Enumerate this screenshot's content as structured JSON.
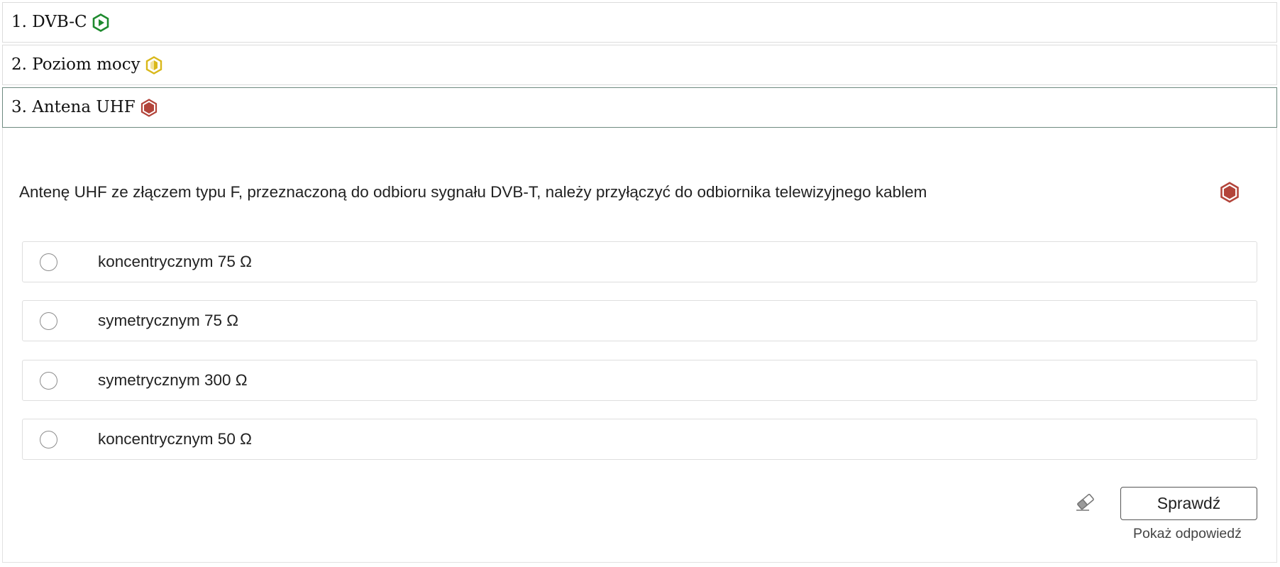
{
  "sections": [
    {
      "label": "1. DVB-C",
      "status_icon": "hexagon-play-icon",
      "status_color": "#1e8a2e"
    },
    {
      "label": "2. Poziom mocy",
      "status_icon": "hexagon-half-icon",
      "status_color": "#d9b81a"
    },
    {
      "label": "3. Antena UHF",
      "status_icon": "hexagon-filled-icon",
      "status_color": "#b3443a"
    }
  ],
  "question": {
    "text": "Antenę UHF ze złączem typu F, przeznaczoną do odbioru sygnału DVB-T, należy przyłączyć do odbiornika telewizyjnego kablem",
    "status_icon": "hexagon-filled-icon",
    "status_color": "#b3443a"
  },
  "options": [
    {
      "label": "koncentrycznym 75 Ω"
    },
    {
      "label": "symetrycznym 75 Ω"
    },
    {
      "label": "symetrycznym 300 Ω"
    },
    {
      "label": "koncentrycznym 50 Ω"
    }
  ],
  "actions": {
    "clear_icon": "eraser-icon",
    "check_label": "Sprawdź",
    "show_answer_label": "Pokaż odpowiedź"
  }
}
